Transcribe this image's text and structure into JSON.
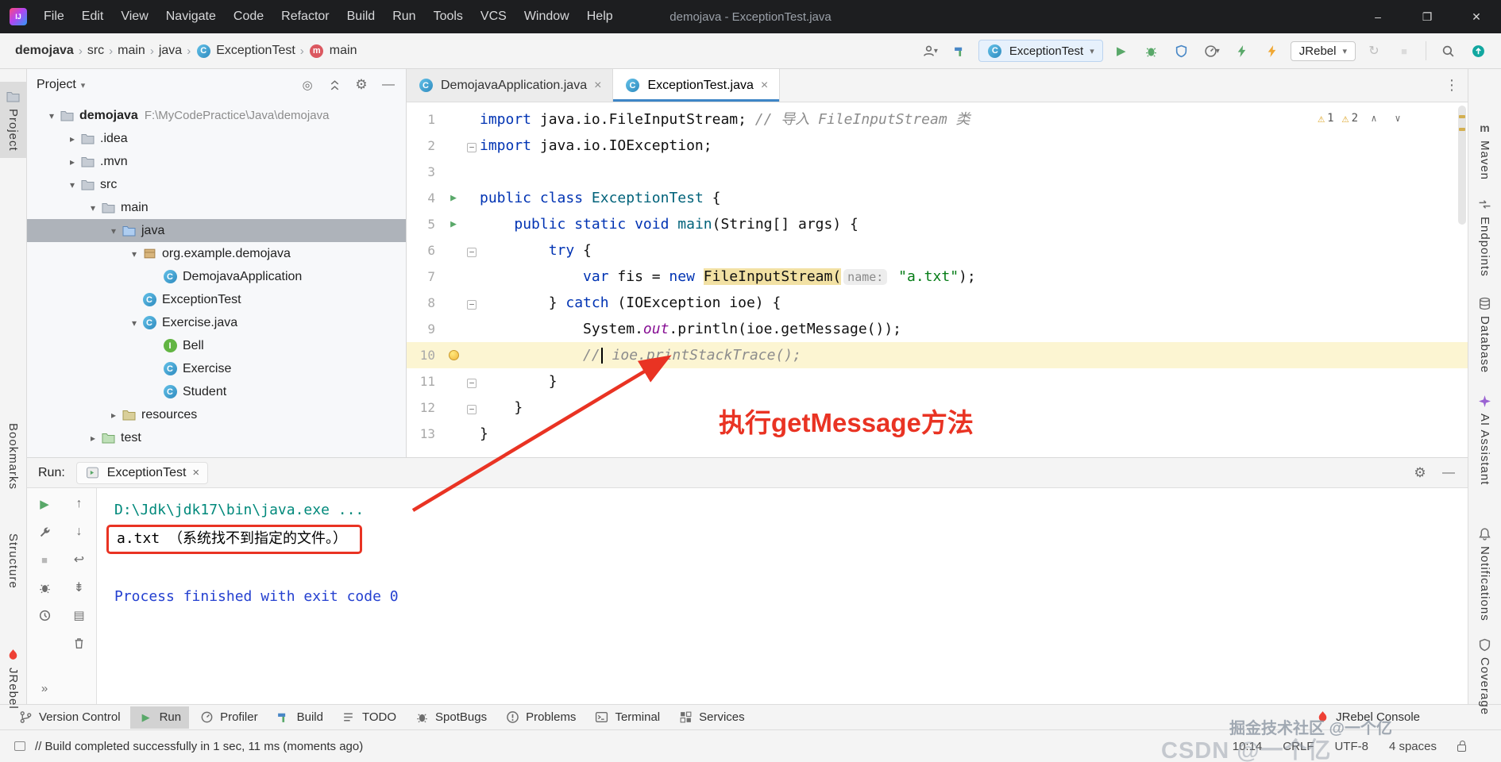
{
  "colors": {
    "accent": "#3E86C7",
    "error_red": "#E93323",
    "warning": "#DEA82F",
    "run_green": "#59A869",
    "console_cmd": "#00897B",
    "console_system": "#2440D0",
    "current_line": "#FCF5D2",
    "identifier_highlight": "#F2E1A4"
  },
  "titlebar": {
    "logo": "IJ",
    "menus": [
      "File",
      "Edit",
      "View",
      "Navigate",
      "Code",
      "Refactor",
      "Build",
      "Run",
      "Tools",
      "VCS",
      "Window",
      "Help"
    ],
    "title": "demojava - ExceptionTest.java",
    "controls": {
      "minimize": "–",
      "maximize": "❐",
      "close": "✕"
    }
  },
  "breadcrumbs": [
    {
      "label": "demojava",
      "bold": true
    },
    {
      "label": "src"
    },
    {
      "label": "main"
    },
    {
      "label": "java"
    },
    {
      "label": "ExceptionTest",
      "icon": "class"
    },
    {
      "label": "main",
      "icon": "method"
    }
  ],
  "toolbar_right": [
    {
      "type": "icon",
      "icon": "user",
      "dropdown": true
    },
    {
      "type": "icon",
      "icon": "hammer"
    },
    {
      "type": "combo",
      "icon": "class",
      "label": "ExceptionTest",
      "name": "run-config"
    },
    {
      "type": "icon",
      "icon": "run"
    },
    {
      "type": "icon",
      "icon": "debug"
    },
    {
      "type": "icon",
      "icon": "coverage"
    },
    {
      "type": "icon",
      "icon": "profiler",
      "dropdown": true
    },
    {
      "type": "icon",
      "icon": "zap-green"
    },
    {
      "type": "icon",
      "icon": "zap-orange"
    },
    {
      "type": "combo",
      "label": "JRebel",
      "name": "jrebel"
    },
    {
      "type": "icon",
      "icon": "restart",
      "disabled": true
    },
    {
      "type": "icon",
      "icon": "stop",
      "disabled": true
    },
    {
      "type": "sep"
    },
    {
      "type": "icon",
      "icon": "search"
    },
    {
      "type": "icon",
      "icon": "update"
    }
  ],
  "left_strip": [
    {
      "label": "Project",
      "icon": "folder",
      "active": true
    },
    {
      "label": "Bookmarks"
    },
    {
      "label": "Structure"
    },
    {
      "label": "JRebel",
      "icon": "jrebel"
    }
  ],
  "right_strip": [
    {
      "label": "Maven",
      "icon": "m-logo"
    },
    {
      "label": "Endpoints",
      "icon": "endpoints"
    },
    {
      "label": "Database",
      "icon": "database"
    },
    {
      "label": "AI Assistant",
      "icon": "ai"
    },
    {
      "label": "Notifications",
      "icon": "bell"
    },
    {
      "label": "Coverage",
      "icon": "coverage-shield"
    }
  ],
  "project_panel": {
    "title": "Project",
    "header_icons": [
      "locate",
      "collapse-all",
      "settings",
      "hide"
    ],
    "tree": [
      {
        "label": "demojava",
        "path": "F:\\MyCodePractice\\Java\\demojava",
        "level": 0,
        "icon": "folder",
        "chevron": "open",
        "bold": true
      },
      {
        "label": ".idea",
        "level": 1,
        "icon": "folder",
        "chevron": "closed"
      },
      {
        "label": ".mvn",
        "level": 1,
        "icon": "folder",
        "chevron": "closed"
      },
      {
        "label": "src",
        "level": 1,
        "icon": "folder",
        "chevron": "open"
      },
      {
        "label": "main",
        "level": 2,
        "icon": "folder",
        "chevron": "open"
      },
      {
        "label": "java",
        "level": 3,
        "icon": "folder-source",
        "chevron": "open",
        "selected": true
      },
      {
        "label": "org.example.demojava",
        "level": 4,
        "icon": "package",
        "chevron": "open"
      },
      {
        "label": "DemojavaApplication",
        "level": 5,
        "icon": "class"
      },
      {
        "label": "ExceptionTest",
        "level": 4,
        "icon": "class"
      },
      {
        "label": "Exercise.java",
        "level": 4,
        "icon": "class",
        "chevron": "open"
      },
      {
        "label": "Bell",
        "level": 5,
        "icon": "interface"
      },
      {
        "label": "Exercise",
        "level": 5,
        "icon": "class"
      },
      {
        "label": "Student",
        "level": 5,
        "icon": "class"
      },
      {
        "label": "resources",
        "level": 3,
        "icon": "folder-resources",
        "chevron": "closed"
      },
      {
        "label": "test",
        "level": 2,
        "icon": "folder-test",
        "chevron": "closed"
      }
    ]
  },
  "editor_tabs": [
    {
      "label": "DemojavaApplication.java",
      "icon": "class"
    },
    {
      "label": "ExceptionTest.java",
      "icon": "class",
      "active": true
    }
  ],
  "editor": {
    "inspections": [
      {
        "icon": "warning",
        "count": "1"
      },
      {
        "icon": "warning",
        "count": "2"
      }
    ],
    "lines": [
      {
        "num": "1",
        "tokens": [
          {
            "t": "import",
            "c": "kw"
          },
          {
            "t": " java.io.FileInputStream; ",
            "c": "pl"
          },
          {
            "t": "// 导入 FileInputStream 类",
            "c": "cm"
          }
        ]
      },
      {
        "num": "2",
        "fold": true,
        "tokens": [
          {
            "t": "import",
            "c": "kw"
          },
          {
            "t": " java.io.IOException;",
            "c": "pl"
          }
        ]
      },
      {
        "num": "3",
        "tokens": []
      },
      {
        "num": "4",
        "run": true,
        "tokens": [
          {
            "t": "public",
            "c": "kw"
          },
          {
            "t": " ",
            "c": "pl"
          },
          {
            "t": "class",
            "c": "kw"
          },
          {
            "t": " ",
            "c": "pl"
          },
          {
            "t": "ExceptionTest",
            "c": "decl"
          },
          {
            "t": " {",
            "c": "pl"
          }
        ]
      },
      {
        "num": "5",
        "run": true,
        "tokens": [
          {
            "t": "    ",
            "c": "pl"
          },
          {
            "t": "public static void",
            "c": "kw"
          },
          {
            "t": " ",
            "c": "pl"
          },
          {
            "t": "main",
            "c": "decl"
          },
          {
            "t": "(String[] args) {",
            "c": "pl"
          }
        ]
      },
      {
        "num": "6",
        "fold": true,
        "tokens": [
          {
            "t": "        ",
            "c": "pl"
          },
          {
            "t": "try",
            "c": "kw"
          },
          {
            "t": " {",
            "c": "pl"
          }
        ]
      },
      {
        "num": "7",
        "tokens": [
          {
            "t": "            ",
            "c": "pl"
          },
          {
            "t": "var",
            "c": "kw"
          },
          {
            "t": " fis = ",
            "c": "pl"
          },
          {
            "t": "new",
            "c": "kw"
          },
          {
            "t": " ",
            "c": "pl"
          },
          {
            "t": "FileInputStream(",
            "c": "hl"
          },
          {
            "t": "name:",
            "c": "hint"
          },
          {
            "t": " ",
            "c": "pl"
          },
          {
            "t": "\"a.txt\"",
            "c": "str"
          },
          {
            "t": ");",
            "c": "pl"
          }
        ]
      },
      {
        "num": "8",
        "fold": true,
        "tokens": [
          {
            "t": "        } ",
            "c": "pl"
          },
          {
            "t": "catch",
            "c": "kw"
          },
          {
            "t": " (IOException ioe) {",
            "c": "pl"
          }
        ]
      },
      {
        "num": "9",
        "tokens": [
          {
            "t": "            System.",
            "c": "pl"
          },
          {
            "t": "out",
            "c": "fld"
          },
          {
            "t": ".println(ioe.getMessage());",
            "c": "pl"
          }
        ]
      },
      {
        "num": "10",
        "bulb": true,
        "current": true,
        "tokens": [
          {
            "t": "            ",
            "c": "pl"
          },
          {
            "t": "//",
            "c": "cm"
          },
          {
            "t": "",
            "c": "caret"
          },
          {
            "t": " ioe.printStackTrace();",
            "c": "cm"
          }
        ]
      },
      {
        "num": "11",
        "fold": true,
        "tokens": [
          {
            "t": "        }",
            "c": "pl"
          }
        ]
      },
      {
        "num": "12",
        "fold": true,
        "tokens": [
          {
            "t": "    }",
            "c": "pl"
          }
        ]
      },
      {
        "num": "13",
        "tokens": [
          {
            "t": "}",
            "c": "pl"
          }
        ]
      }
    ]
  },
  "annotation": {
    "text": "执行getMessage方法"
  },
  "run_panel": {
    "label": "Run:",
    "tab": "ExceptionTest",
    "header_icons": [
      "settings",
      "hide"
    ],
    "console": [
      {
        "text": "D:\\Jdk\\jdk17\\bin\\java.exe ...",
        "style": "cmd"
      },
      {
        "text": "a.txt （系统找不到指定的文件。）",
        "style": "out",
        "boxed": true
      },
      {
        "text": "",
        "style": "out"
      },
      {
        "text": "Process finished with exit code 0",
        "style": "sys"
      }
    ]
  },
  "run_toolbar": {
    "colA": [
      "rerun",
      "wrench",
      "stop",
      "ant",
      "history",
      "more"
    ],
    "colB": [
      "up",
      "down",
      "softwrap",
      "scroll-end",
      "print",
      "clear"
    ]
  },
  "bottom_bar": {
    "items": [
      {
        "label": "Version Control",
        "icon": "branch"
      },
      {
        "label": "Run",
        "icon": "play",
        "active": true
      },
      {
        "label": "Profiler",
        "icon": "gauge"
      },
      {
        "label": "Build",
        "icon": "hammer"
      },
      {
        "label": "TODO",
        "icon": "todo"
      },
      {
        "label": "SpotBugs",
        "icon": "bug"
      },
      {
        "label": "Problems",
        "icon": "problem"
      },
      {
        "label": "Terminal",
        "icon": "terminal"
      },
      {
        "label": "Services",
        "icon": "services"
      }
    ],
    "right": {
      "label": "JRebel Console",
      "icon": "jrebel"
    }
  },
  "statusbar": {
    "message": "// Build completed successfully in 1 sec, 11 ms (moments ago)",
    "position": "10:14",
    "line_sep": "CRLF",
    "encoding": "UTF-8",
    "indent": "4 spaces"
  },
  "watermarks": {
    "wm1": "掘金技术社区 @一个亿",
    "wm2": "CSDN @一个亿"
  }
}
